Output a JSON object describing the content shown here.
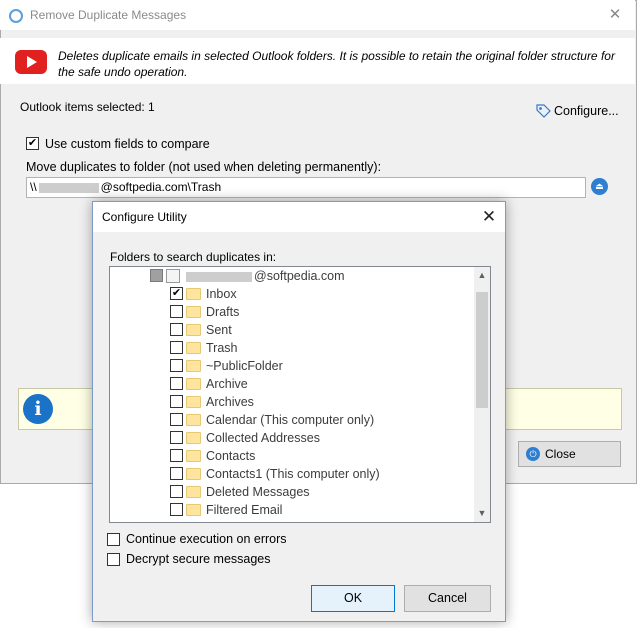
{
  "main_window": {
    "title": "Remove Duplicate Messages",
    "close_glyph": "✕",
    "description": "Deletes duplicate emails in selected Outlook folders. It is possible to retain the original folder structure for the safe undo operation.",
    "items_selected": "Outlook items selected: 1",
    "configure_link": "Configure...",
    "use_custom_fields": {
      "label": "Use custom fields to compare",
      "checked": true
    },
    "move_label": "Move duplicates to folder (not used when deleting permanently):",
    "path_prefix": "\\\\",
    "path_suffix": "@softpedia.com\\Trash",
    "close_button": "Close",
    "info_glyph": "i",
    "eject_glyph": "⏏",
    "power_glyph": "⏻"
  },
  "dialog": {
    "title": "Configure Utility",
    "close_glyph": "✕",
    "folders_label": "Folders to search duplicates in:",
    "account_suffix": "@softpedia.com",
    "folders": [
      {
        "label": "Inbox",
        "checked": true
      },
      {
        "label": "Drafts",
        "checked": false
      },
      {
        "label": "Sent",
        "checked": false
      },
      {
        "label": "Trash",
        "checked": false
      },
      {
        "label": "~PublicFolder",
        "checked": false
      },
      {
        "label": "Archive",
        "checked": false
      },
      {
        "label": "Archives",
        "checked": false
      },
      {
        "label": "Calendar (This computer only)",
        "checked": false
      },
      {
        "label": "Collected Addresses",
        "checked": false
      },
      {
        "label": "Contacts",
        "checked": false
      },
      {
        "label": "Contacts1 (This computer only)",
        "checked": false
      },
      {
        "label": "Deleted Messages",
        "checked": false
      },
      {
        "label": "Filtered Email",
        "checked": false
      }
    ],
    "continue_on_errors": {
      "label": "Continue execution on errors",
      "checked": false
    },
    "decrypt_secure": {
      "label": "Decrypt secure messages",
      "checked": false
    },
    "ok_button": "OK",
    "cancel_button": "Cancel",
    "scroll_up_glyph": "▲",
    "scroll_down_glyph": "▼",
    "check_glyph": "✔"
  },
  "colors": {
    "accent": "#0078d7",
    "info_bg": "#ffffe5",
    "brand_red": "#e1211f"
  }
}
